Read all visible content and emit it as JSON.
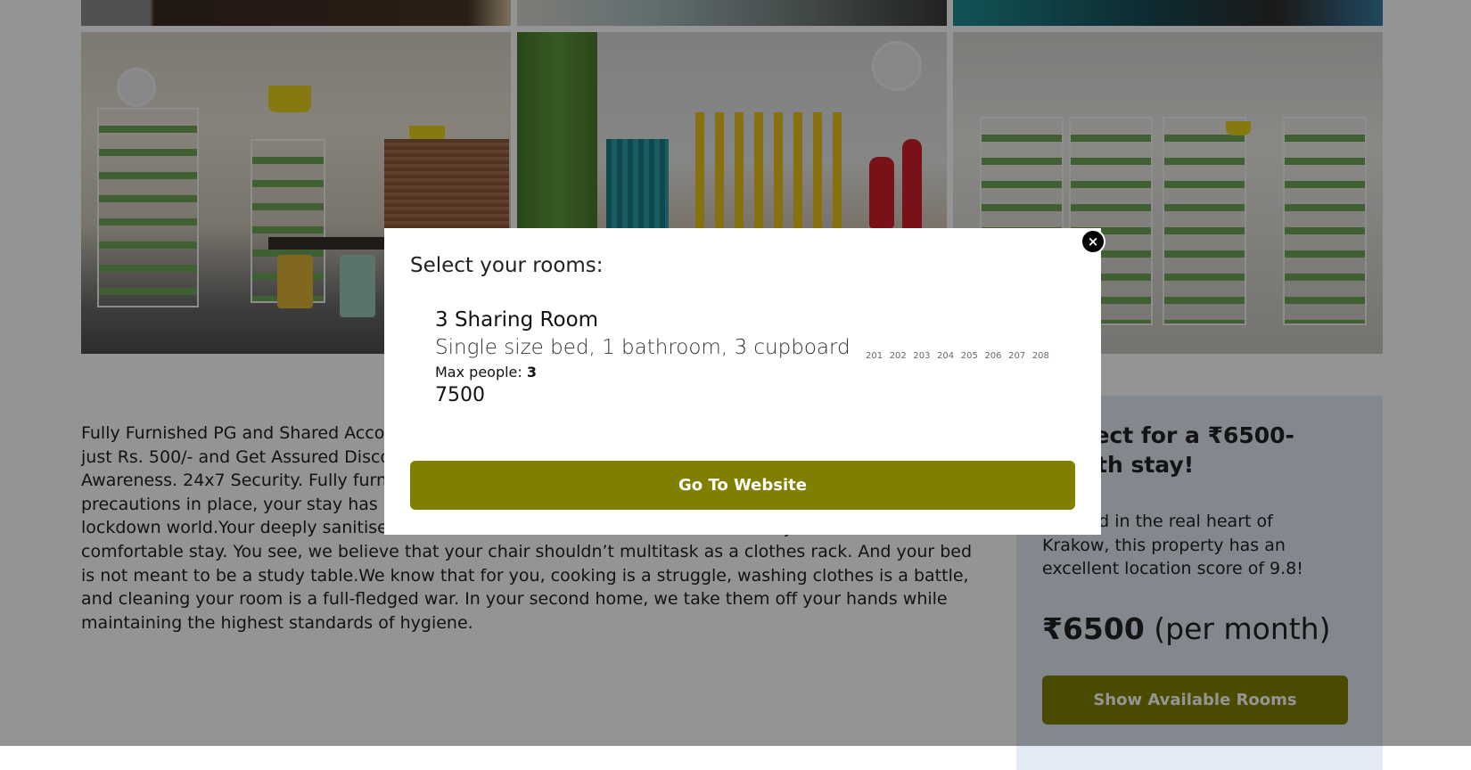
{
  "description": {
    "text": "Fully Furnished PG and Shared Accommodation Starting from Rs 6500 /month. Book Your Room Now at just Rs. 500/- and Get Assured Discount on Rent. Move-in Ready, Safe and Affordable. Wellness & Awareness. 24x7 Security. Fully furnished rooms. And here’s why, with a comprehensive list of precautions in place, your stay has always been safe and will continue to be so even in the post lockdown world.Your deeply sanitised room will have all the furniture and facilities you need for a comfortable stay. You see, we believe that your chair shouldn’t multitask as a clothes rack. And your bed is not meant to be a study table.We know that for you, cooking is a struggle, washing clothes is a battle, and cleaning your room is a full-fledged war. In your second home, we take them off your hands while maintaining the highest standards of hygiene."
  },
  "card": {
    "title": "Perfect for a ₹6500-month stay!",
    "text": "Located in the real heart of Krakow, this property has an excellent location score of 9.8!",
    "price": "₹6500",
    "price_suffix": " (per month)",
    "button_label": "Show Available Rooms"
  },
  "modal": {
    "close_symbol": "×",
    "title": "Select your rooms:",
    "room": {
      "name": "3 Sharing Room",
      "description": "Single size bed, 1 bathroom, 3 cupboard",
      "max_people_label": "Max people: ",
      "max_people": "3",
      "price": "7500",
      "numbers": [
        "201",
        "202",
        "203",
        "204",
        "205",
        "206",
        "207",
        "208"
      ]
    },
    "button_label": "Go To Website"
  },
  "colors": {
    "accent": "#808000",
    "card_bg": "#e2ebf5"
  }
}
